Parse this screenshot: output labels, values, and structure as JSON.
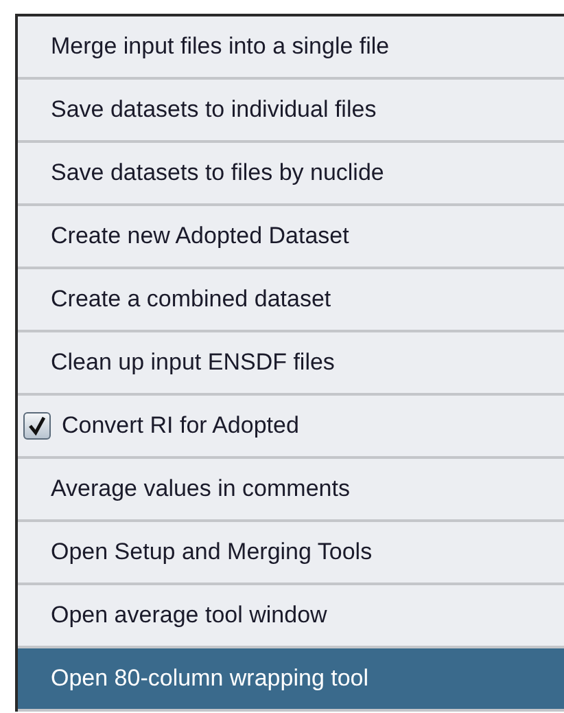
{
  "menu": {
    "items": [
      {
        "kind": "command",
        "label": "Merge input files into a single file",
        "selected": false
      },
      {
        "kind": "command",
        "label": "Save datasets to individual files",
        "selected": false
      },
      {
        "kind": "command",
        "label": "Save datasets to files by nuclide",
        "selected": false
      },
      {
        "kind": "command",
        "label": "Create new Adopted Dataset",
        "selected": false
      },
      {
        "kind": "command",
        "label": "Create a combined dataset",
        "selected": false
      },
      {
        "kind": "command",
        "label": "Clean up input ENSDF files",
        "selected": false
      },
      {
        "kind": "check",
        "label": "Convert RI for Adopted",
        "checked": true,
        "selected": false
      },
      {
        "kind": "command",
        "label": "Average values in comments",
        "selected": false
      },
      {
        "kind": "command",
        "label": "Open Setup and Merging Tools",
        "selected": false
      },
      {
        "kind": "command",
        "label": "Open average tool window",
        "selected": false
      },
      {
        "kind": "command",
        "label": "Open 80-column wrapping tool",
        "selected": true
      }
    ]
  }
}
